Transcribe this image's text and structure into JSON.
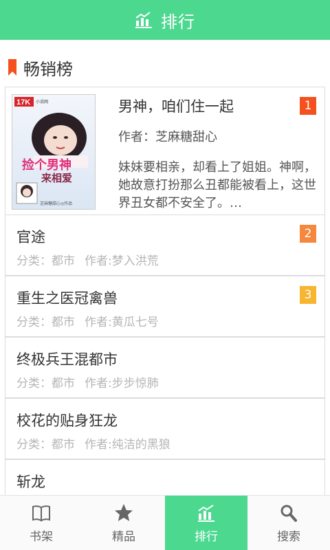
{
  "header": {
    "title": "排行",
    "icon": "chart-icon"
  },
  "section": {
    "title": "畅销榜",
    "icon": "bookmark-icon"
  },
  "featured": {
    "rank": "1",
    "rank_color": "#f4511e",
    "title": "男神，咱们住一起",
    "author": "作者：芝麻糖甜心",
    "description": "妹妹要相亲，却看上了姐姐。神啊，她故意打扮那么丑都能被看上，这世界丑女都不安全了。…",
    "cover": {
      "logo": "17K",
      "logo_sub": "小说网",
      "title_line1": "捡个男神",
      "title_line2": "来相爱",
      "author_line": "芝麻糖甜心◎作品"
    }
  },
  "books": [
    {
      "rank": "2",
      "rank_color": "#f5883d",
      "title": "官途",
      "category": "分类：都市",
      "author": "作者:梦入洪荒"
    },
    {
      "rank": "3",
      "rank_color": "#f8b530",
      "title": "重生之医冠禽兽",
      "category": "分类：都市",
      "author": "作者:黄瓜七号"
    },
    {
      "rank": "",
      "title": "终极兵王混都市",
      "category": "分类：都市",
      "author": "作者:步步惊肺"
    },
    {
      "rank": "",
      "title": "校花的贴身狂龙",
      "category": "分类：都市",
      "author": "作者:纯洁的黑狼"
    },
    {
      "rank": "",
      "title": "斩龙",
      "category": "",
      "author": ""
    }
  ],
  "tabs": [
    {
      "label": "书架",
      "icon": "book-icon",
      "active": false
    },
    {
      "label": "精品",
      "icon": "star-icon",
      "active": false
    },
    {
      "label": "排行",
      "icon": "chart-icon",
      "active": true
    },
    {
      "label": "搜索",
      "icon": "search-icon",
      "active": false
    }
  ],
  "colors": {
    "accent": "#4cd88f",
    "border": "#dcdcdc",
    "meta_text": "#b5b5b5"
  }
}
